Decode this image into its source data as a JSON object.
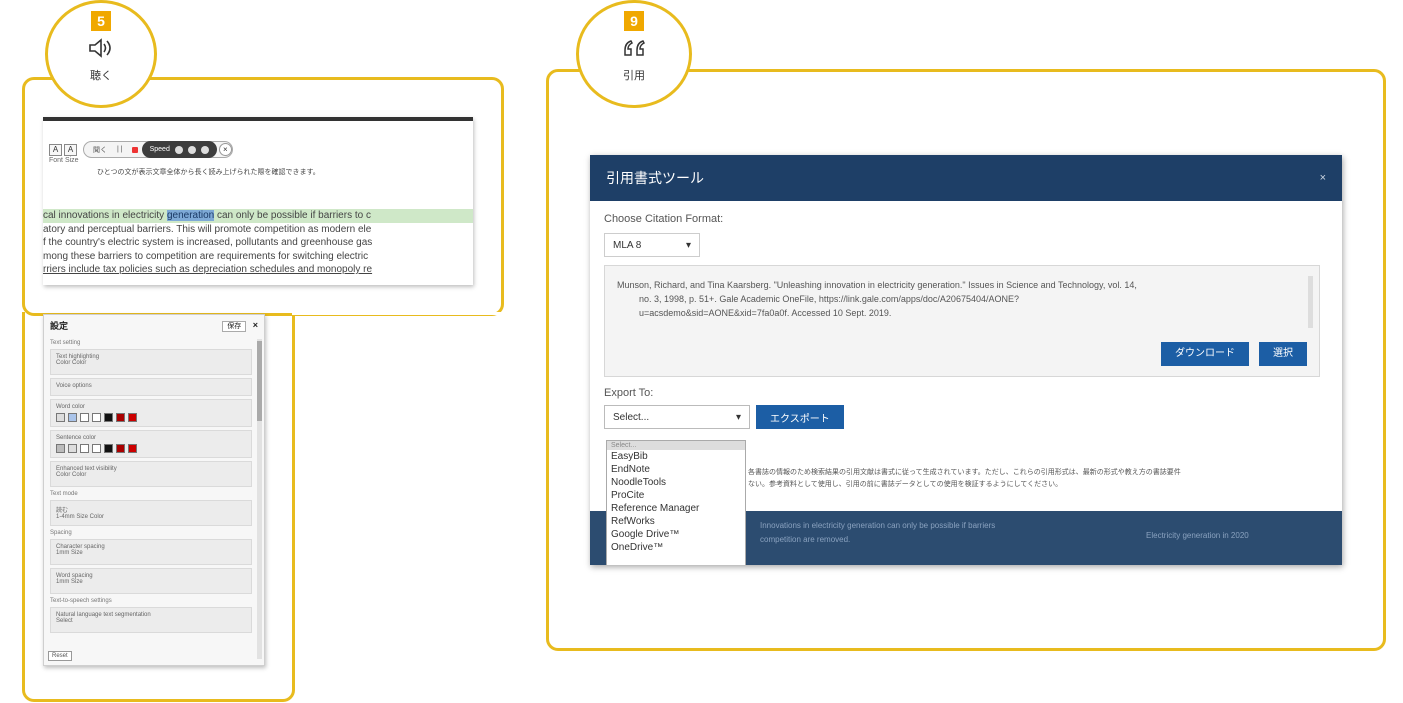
{
  "badges": {
    "listen": {
      "number": "5",
      "icon": "speaker-icon",
      "label": "聴く"
    },
    "cite": {
      "number": "9",
      "icon": "quote-icon",
      "label": "引用"
    }
  },
  "listen_panel": {
    "font_size_label": "Font Size",
    "player": {
      "listen_label": "聞く",
      "pause_label": "| |",
      "speed_label": "Speed",
      "close": "×"
    },
    "hint": "ひとつの文が表示文章全体から長く読み上げられた際を確認できます。",
    "passage": {
      "line1_before": "cal innovations in electricity ",
      "line1_word": "generation",
      "line1_after": " can only be possible if barriers to c",
      "line2": "atory and perceptual barriers. This will promote competition as modern ele",
      "line3": "f the country's electric system is increased, pollutants and greenhouse gas",
      "line4": "mong these barriers to competition are requirements for switching electric",
      "line5": "rriers include tax policies such as depreciation schedules and monopoly re"
    }
  },
  "settings_panel": {
    "title": "設定",
    "save_label": "保存",
    "close": "×",
    "sections": [
      {
        "label": "Text setting",
        "lines": [
          "Text highlighting",
          "Color  Color"
        ]
      },
      {
        "label": "",
        "lines": [
          "Voice options"
        ]
      },
      {
        "label": "",
        "lines": [
          "Word color"
        ]
      },
      {
        "label": "",
        "lines": [
          "Sentence color"
        ]
      },
      {
        "label": "",
        "lines": [
          "Enhanced text visibility",
          "Color  Color"
        ]
      },
      {
        "label": "Text mode",
        "lines": [
          "読む",
          "1-4mm  Size  Color"
        ]
      },
      {
        "label": "Spacing",
        "lines": [
          "Character spacing",
          "1mm  Size"
        ]
      },
      {
        "label": "",
        "lines": [
          "Word spacing",
          "1mm  Size"
        ]
      },
      {
        "label": "Text-to-speech settings",
        "lines": [
          "Natural language text segmentation",
          "Select"
        ]
      }
    ],
    "footer": "Reset"
  },
  "citation_tool": {
    "title": "引用書式ツール",
    "close": "×",
    "format_label": "Choose Citation Format:",
    "format_value": "MLA 8",
    "citation_line1": "Munson, Richard, and Tina Kaarsberg. \"Unleashing innovation in electricity generation.\" Issues in Science and Technology, vol. 14,",
    "citation_line2": "no. 3, 1998, p. 51+. Gale Academic OneFile, https://link.gale.com/apps/doc/A20675404/AONE?",
    "citation_line3": "u=acsdemo&sid=AONE&xid=7fa0a0f. Accessed 10 Sept. 2019.",
    "download_label": "ダウンロード",
    "select_label": "選択",
    "export_label": "Export To:",
    "export_value": "Select...",
    "export_button": "エクスポート",
    "export_options": [
      "Select...",
      "EasyBib",
      "EndNote",
      "NoodleTools",
      "ProCite",
      "Reference Manager",
      "RefWorks",
      "Google Drive™",
      "OneDrive™"
    ],
    "notice_line1": "各書誌の情報のため検索結果の引用文献は書式に従って生成されています。ただし、これらの引用形式は、最新の形式や教え方の書誌要件",
    "notice_line2": "ない。参考資料として使用し、引用の前に書誌データとしての使用を検証するようにしてください。",
    "background_line1": "Innovations in electricity generation can only be possible if barriers",
    "background_line2": "competition are removed.",
    "background_right": "Electricity generation in 2020"
  },
  "colors": {
    "frame": "#e8bb1e",
    "badge_number": "#f0a800",
    "dialog_header": "#1e3f67",
    "button": "#1c5ea5"
  }
}
